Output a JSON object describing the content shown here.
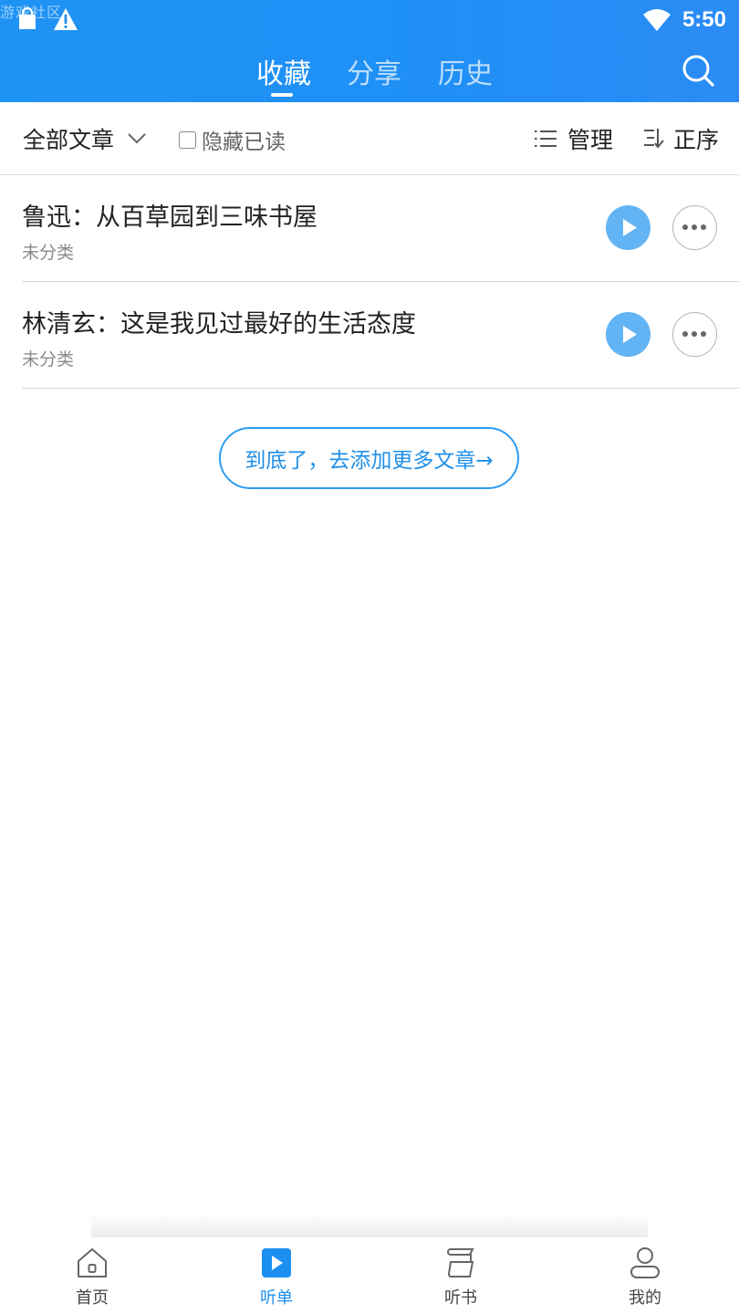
{
  "status_bar": {
    "watermark": "游戏社区",
    "time": "5:50"
  },
  "header": {
    "tabs": [
      {
        "label": "收藏",
        "active": true
      },
      {
        "label": "分享",
        "active": false
      },
      {
        "label": "历史",
        "active": false
      }
    ],
    "search_icon": "search-icon"
  },
  "filters": {
    "category_label": "全部文章",
    "hide_read_label": "隐藏已读",
    "hide_read_checked": false,
    "manage_label": "管理",
    "order_label": "正序"
  },
  "articles": [
    {
      "title": "鲁迅：从百草园到三味书屋",
      "category": "未分类"
    },
    {
      "title": "林清玄：这是我见过最好的生活态度",
      "category": "未分类"
    }
  ],
  "end_of_list": {
    "label": "到底了，去添加更多文章→"
  },
  "bottom_nav": [
    {
      "label": "首页",
      "icon": "home-icon",
      "active": false
    },
    {
      "label": "听单",
      "icon": "play-list-icon",
      "active": true
    },
    {
      "label": "听书",
      "icon": "book-icon",
      "active": false
    },
    {
      "label": "我的",
      "icon": "user-icon",
      "active": false
    }
  ],
  "colors": {
    "brand_blue": "#1f93f4",
    "play_button": "#63b4f4",
    "active_nav": "#1c8ff0"
  }
}
